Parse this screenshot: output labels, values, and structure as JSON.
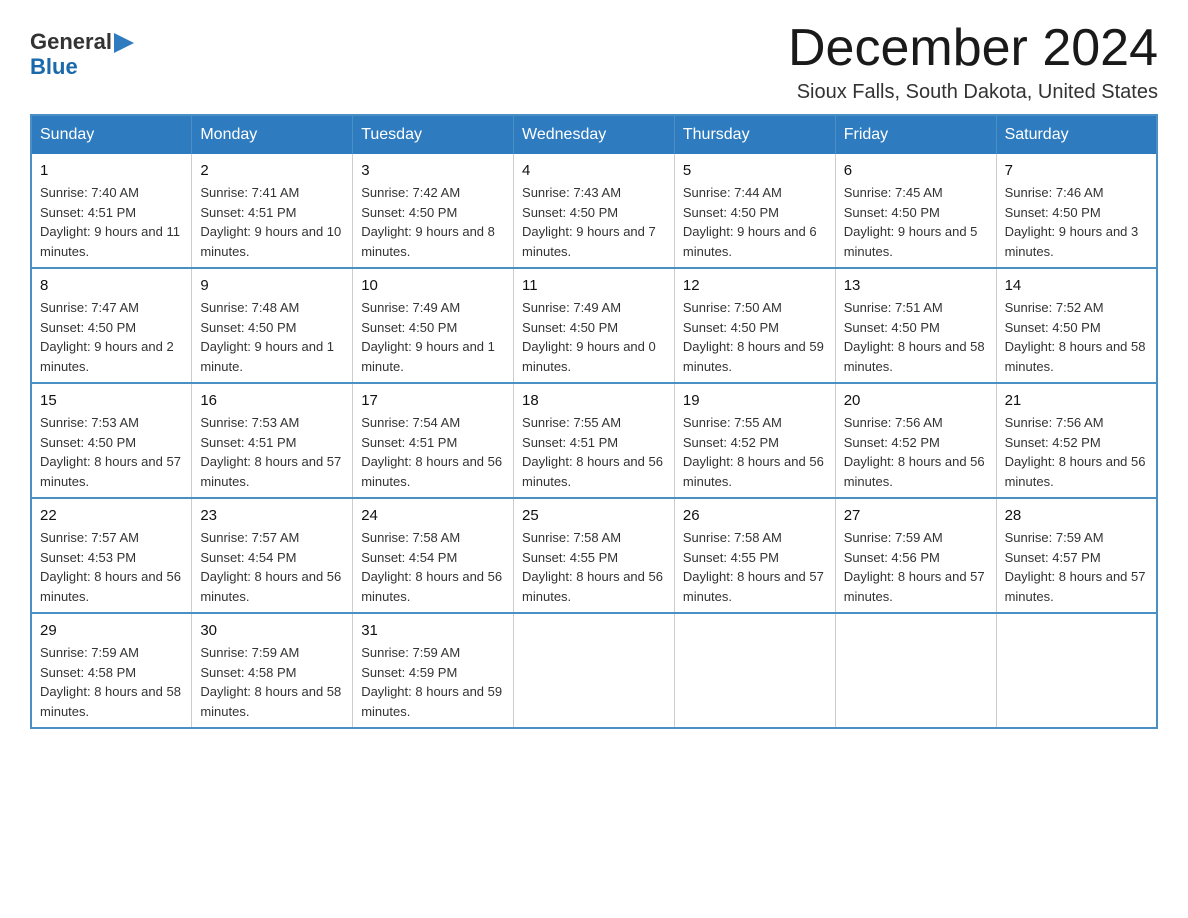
{
  "logo": {
    "line1": "General",
    "triangle": "▶",
    "line2": "Blue"
  },
  "title": "December 2024",
  "subtitle": "Sioux Falls, South Dakota, United States",
  "days_of_week": [
    "Sunday",
    "Monday",
    "Tuesday",
    "Wednesday",
    "Thursday",
    "Friday",
    "Saturday"
  ],
  "weeks": [
    [
      {
        "day": "1",
        "sunrise": "7:40 AM",
        "sunset": "4:51 PM",
        "daylight": "9 hours and 11 minutes."
      },
      {
        "day": "2",
        "sunrise": "7:41 AM",
        "sunset": "4:51 PM",
        "daylight": "9 hours and 10 minutes."
      },
      {
        "day": "3",
        "sunrise": "7:42 AM",
        "sunset": "4:50 PM",
        "daylight": "9 hours and 8 minutes."
      },
      {
        "day": "4",
        "sunrise": "7:43 AM",
        "sunset": "4:50 PM",
        "daylight": "9 hours and 7 minutes."
      },
      {
        "day": "5",
        "sunrise": "7:44 AM",
        "sunset": "4:50 PM",
        "daylight": "9 hours and 6 minutes."
      },
      {
        "day": "6",
        "sunrise": "7:45 AM",
        "sunset": "4:50 PM",
        "daylight": "9 hours and 5 minutes."
      },
      {
        "day": "7",
        "sunrise": "7:46 AM",
        "sunset": "4:50 PM",
        "daylight": "9 hours and 3 minutes."
      }
    ],
    [
      {
        "day": "8",
        "sunrise": "7:47 AM",
        "sunset": "4:50 PM",
        "daylight": "9 hours and 2 minutes."
      },
      {
        "day": "9",
        "sunrise": "7:48 AM",
        "sunset": "4:50 PM",
        "daylight": "9 hours and 1 minute."
      },
      {
        "day": "10",
        "sunrise": "7:49 AM",
        "sunset": "4:50 PM",
        "daylight": "9 hours and 1 minute."
      },
      {
        "day": "11",
        "sunrise": "7:49 AM",
        "sunset": "4:50 PM",
        "daylight": "9 hours and 0 minutes."
      },
      {
        "day": "12",
        "sunrise": "7:50 AM",
        "sunset": "4:50 PM",
        "daylight": "8 hours and 59 minutes."
      },
      {
        "day": "13",
        "sunrise": "7:51 AM",
        "sunset": "4:50 PM",
        "daylight": "8 hours and 58 minutes."
      },
      {
        "day": "14",
        "sunrise": "7:52 AM",
        "sunset": "4:50 PM",
        "daylight": "8 hours and 58 minutes."
      }
    ],
    [
      {
        "day": "15",
        "sunrise": "7:53 AM",
        "sunset": "4:50 PM",
        "daylight": "8 hours and 57 minutes."
      },
      {
        "day": "16",
        "sunrise": "7:53 AM",
        "sunset": "4:51 PM",
        "daylight": "8 hours and 57 minutes."
      },
      {
        "day": "17",
        "sunrise": "7:54 AM",
        "sunset": "4:51 PM",
        "daylight": "8 hours and 56 minutes."
      },
      {
        "day": "18",
        "sunrise": "7:55 AM",
        "sunset": "4:51 PM",
        "daylight": "8 hours and 56 minutes."
      },
      {
        "day": "19",
        "sunrise": "7:55 AM",
        "sunset": "4:52 PM",
        "daylight": "8 hours and 56 minutes."
      },
      {
        "day": "20",
        "sunrise": "7:56 AM",
        "sunset": "4:52 PM",
        "daylight": "8 hours and 56 minutes."
      },
      {
        "day": "21",
        "sunrise": "7:56 AM",
        "sunset": "4:52 PM",
        "daylight": "8 hours and 56 minutes."
      }
    ],
    [
      {
        "day": "22",
        "sunrise": "7:57 AM",
        "sunset": "4:53 PM",
        "daylight": "8 hours and 56 minutes."
      },
      {
        "day": "23",
        "sunrise": "7:57 AM",
        "sunset": "4:54 PM",
        "daylight": "8 hours and 56 minutes."
      },
      {
        "day": "24",
        "sunrise": "7:58 AM",
        "sunset": "4:54 PM",
        "daylight": "8 hours and 56 minutes."
      },
      {
        "day": "25",
        "sunrise": "7:58 AM",
        "sunset": "4:55 PM",
        "daylight": "8 hours and 56 minutes."
      },
      {
        "day": "26",
        "sunrise": "7:58 AM",
        "sunset": "4:55 PM",
        "daylight": "8 hours and 57 minutes."
      },
      {
        "day": "27",
        "sunrise": "7:59 AM",
        "sunset": "4:56 PM",
        "daylight": "8 hours and 57 minutes."
      },
      {
        "day": "28",
        "sunrise": "7:59 AM",
        "sunset": "4:57 PM",
        "daylight": "8 hours and 57 minutes."
      }
    ],
    [
      {
        "day": "29",
        "sunrise": "7:59 AM",
        "sunset": "4:58 PM",
        "daylight": "8 hours and 58 minutes."
      },
      {
        "day": "30",
        "sunrise": "7:59 AM",
        "sunset": "4:58 PM",
        "daylight": "8 hours and 58 minutes."
      },
      {
        "day": "31",
        "sunrise": "7:59 AM",
        "sunset": "4:59 PM",
        "daylight": "8 hours and 59 minutes."
      },
      null,
      null,
      null,
      null
    ]
  ],
  "labels": {
    "sunrise": "Sunrise:",
    "sunset": "Sunset:",
    "daylight": "Daylight:"
  }
}
